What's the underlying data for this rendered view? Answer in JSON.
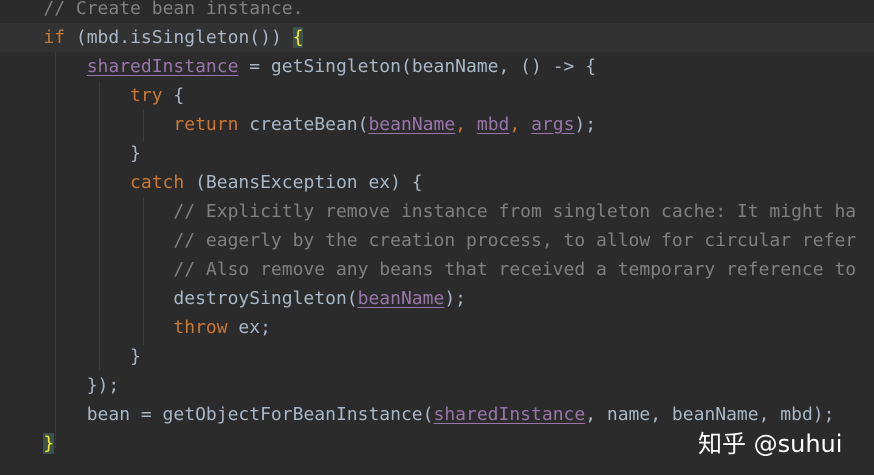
{
  "code": {
    "comment_create": "// Create bean instance.",
    "kw_if": "if",
    "if_cond": " (mbd.isSingleton()) ",
    "brace_open": "{",
    "shared_instance": "sharedInstance",
    "assign_call": " = getSingleton(beanName, () -> {",
    "kw_try": "try",
    "try_brace": " {",
    "kw_return": "return",
    "create_bean": " createBean(",
    "arg_beanname": "beanName",
    "comma1": ", ",
    "arg_mbd": "mbd",
    "comma2": ", ",
    "arg_args": "args",
    "close_call": ");",
    "close_try": "}",
    "kw_catch": "catch",
    "catch_rest": " (BeansException ex) {",
    "comment_1": "// Explicitly remove instance from singleton cache: It might ha",
    "comment_2": "// eagerly by the creation process, to allow for circular refer",
    "comment_3": "// Also remove any beans that received a temporary reference to",
    "destroy_call": "destroySingleton(",
    "destroy_arg": "beanName",
    "destroy_close": ");",
    "kw_throw": "throw",
    "throw_rest": " ex;",
    "close_catch": "}",
    "close_lambda": "});",
    "bean_assign": "bean = getObjectForBeanInstance(",
    "bean_arg_shared": "sharedInstance",
    "bean_args_rest": ", name, beanName, mbd);",
    "close_if": "}"
  },
  "watermark": {
    "text": "知乎 @suhui"
  },
  "colors": {
    "background": "#2b2b2b",
    "keyword": "#cc7832",
    "comment": "#808080",
    "field": "#9876aa",
    "text": "#a9b7c6"
  }
}
